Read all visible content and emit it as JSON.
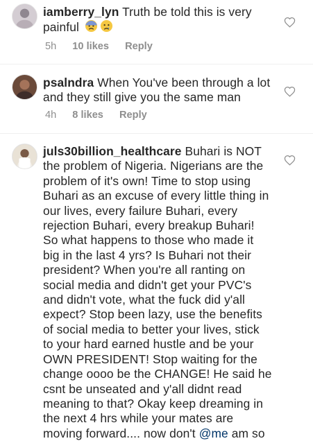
{
  "comments": [
    {
      "username": "iamberry_lyn",
      "text": "Truth be told this is very painful",
      "emojis": [
        "fearful-face",
        "crying-face"
      ],
      "time": "5h",
      "likes": "10 likes",
      "reply": "Reply"
    },
    {
      "username": "psalndra",
      "text": "When You've been through a lot and they still give you the same man",
      "time": "4h",
      "likes": "8 likes",
      "reply": "Reply"
    },
    {
      "username": "juls30billion_healthcare",
      "text": "Buhari is NOT the problem of Nigeria. Nigerians are the problem of it's own! Time to stop using Buhari as an excuse of every little thing in our lives, every failure Buhari, every rejection Buhari, every breakup Buhari! So what happens to those who made it big in the last 4 yrs? Is Buhari not their president? When you're all ranting on social media and didn't get your PVC's and didn't vote, what the fuck did y'all expect? Stop been lazy, use the benefits of social media to better your lives, stick to your hard earned hustle and be your OWN PRESIDENT! Stop waiting for the change oooo be the CHANGE! He said he csnt be unseated and y'all didnt read meaning to that? Okay keep dreaming in the next 4 hrs while your mates are moving forward.... now don't",
      "mention": "@me",
      "tail": "am so"
    }
  ],
  "colors": {
    "text": "#262626",
    "meta": "#8e8e8e",
    "mention": "#003569",
    "heart": "#8e8e8e"
  }
}
